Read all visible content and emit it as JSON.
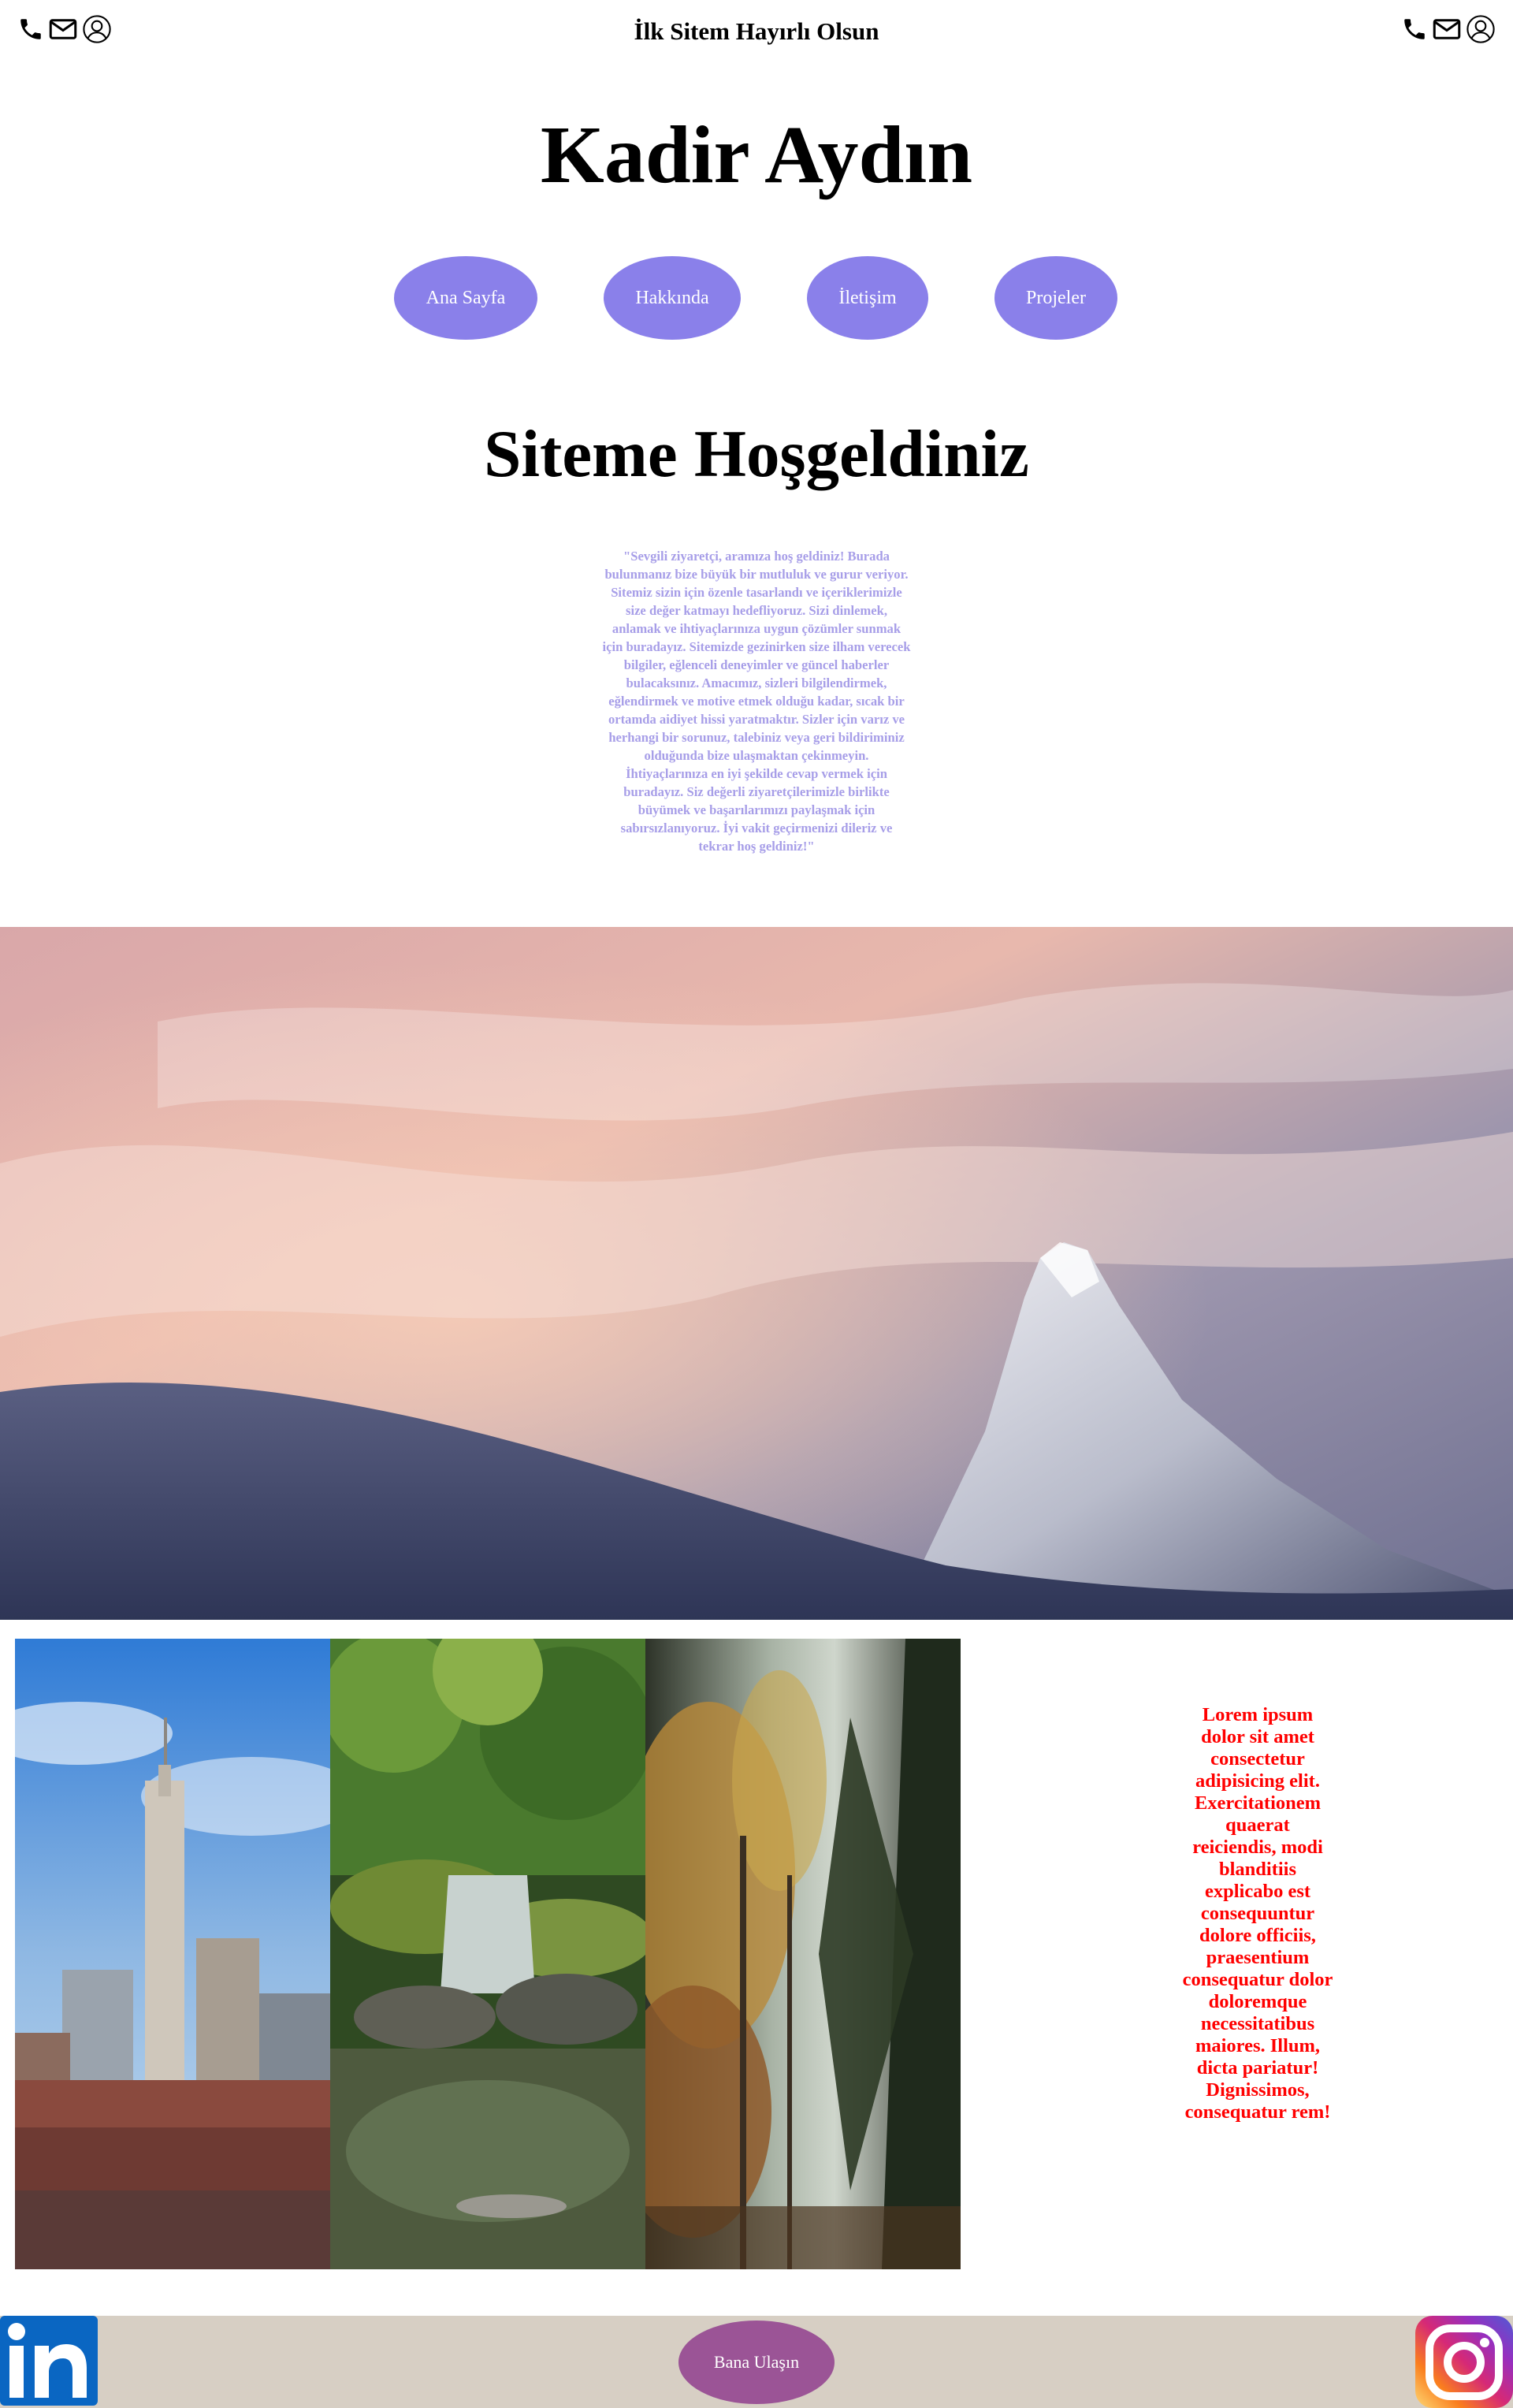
{
  "header": {
    "site_title": "İlk Sitem Hayırlı Olsun",
    "left_icons": [
      "phone-icon",
      "mail-icon",
      "user-icon"
    ],
    "right_icons": [
      "phone-icon",
      "mail-icon",
      "user-icon"
    ]
  },
  "hero_title": "Kadir Aydın",
  "nav": {
    "items": [
      {
        "label": "Ana Sayfa"
      },
      {
        "label": "Hakkında"
      },
      {
        "label": "İletişim"
      },
      {
        "label": "Projeler"
      }
    ]
  },
  "welcome": {
    "title": "Siteme Hoşgeldiniz",
    "message": "\"Sevgili ziyaretçi, aramıza hoş geldiniz! Burada bulunmanız bize büyük bir mutluluk ve gurur veriyor. Sitemiz sizin için özenle tasarlandı ve içeriklerimizle size değer katmayı hedefliyoruz. Sizi dinlemek, anlamak ve ihtiyaçlarınıza uygun çözümler sunmak için buradayız. Sitemizde gezinirken size ilham verecek bilgiler, eğlenceli deneyimler ve güncel haberler bulacaksınız. Amacımız, sizleri bilgilendirmek, eğlendirmek ve motive etmek olduğu kadar, sıcak bir ortamda aidiyet hissi yaratmaktır. Sizler için varız ve herhangi bir sorunuz, talebiniz veya geri bildiriminiz olduğunda bize ulaşmaktan çekinmeyin. İhtiyaçlarınıza en iyi şekilde cevap vermek için buradayız. Siz değerli ziyaretçilerimizle birlikte büyümek ve başarılarımızı paylaşmak için sabırsızlanıyoruz. İyi vakit geçirmenizi dileriz ve tekrar hoş geldiniz!\""
  },
  "colors": {
    "nav_button": "#8a80ea",
    "intro_text": "#a79ee8",
    "side_text": "#ff0000",
    "footer_bg": "#d7cfc4",
    "contact_button": "#9b5496"
  },
  "side_text": "Lorem ipsum dolor sit amet consectetur adipisicing elit. Exercitationem quaerat reiciendis, modi blanditiis explicabo est consequuntur dolore officiis, praesentium consequatur dolor doloremque necessitatibus maiores. Illum, dicta pariatur! Dignissimos, consequatur rem!",
  "footer": {
    "contact_label": "Bana Ulaşın",
    "left_icon": "linkedin-icon",
    "right_icon": "instagram-icon"
  }
}
